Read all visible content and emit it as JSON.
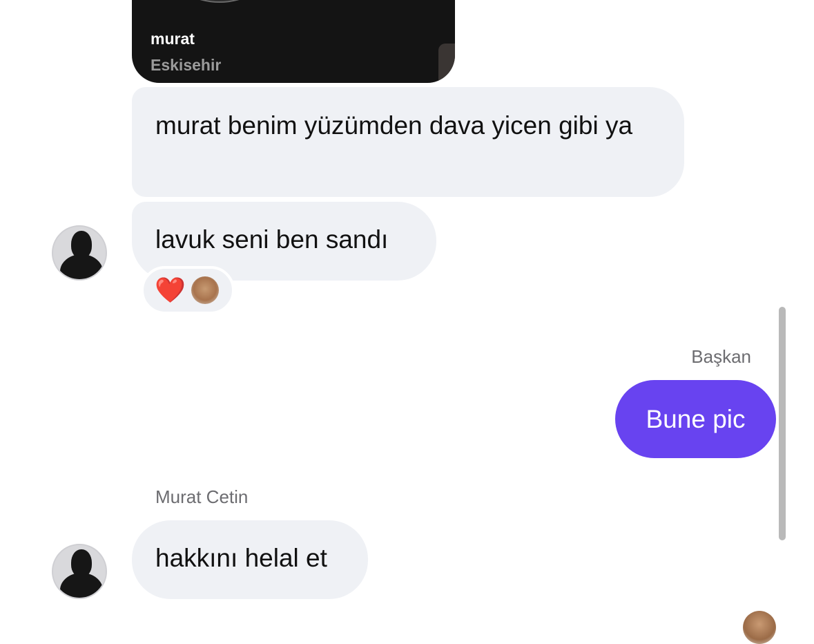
{
  "shared_card": {
    "name": "murat",
    "location": "Eskisehir"
  },
  "messages": [
    {
      "direction": "incoming",
      "text": "murat benim yüzümden dava yicen gibi ya"
    },
    {
      "direction": "incoming",
      "text": "lavuk seni ben sandı",
      "reactions": [
        "heart"
      ]
    },
    {
      "direction": "outgoing",
      "sender": "Başkan",
      "text": "Bune pic"
    },
    {
      "direction": "incoming",
      "sender": "Murat Cetin",
      "text": "hakkını helal et"
    }
  ],
  "colors": {
    "incoming_bubble": "#eff1f5",
    "outgoing_bubble": "#6843f0",
    "card_background": "#141414"
  },
  "icons": {
    "reaction": "heart-emoji",
    "avatar": "person-silhouette"
  }
}
